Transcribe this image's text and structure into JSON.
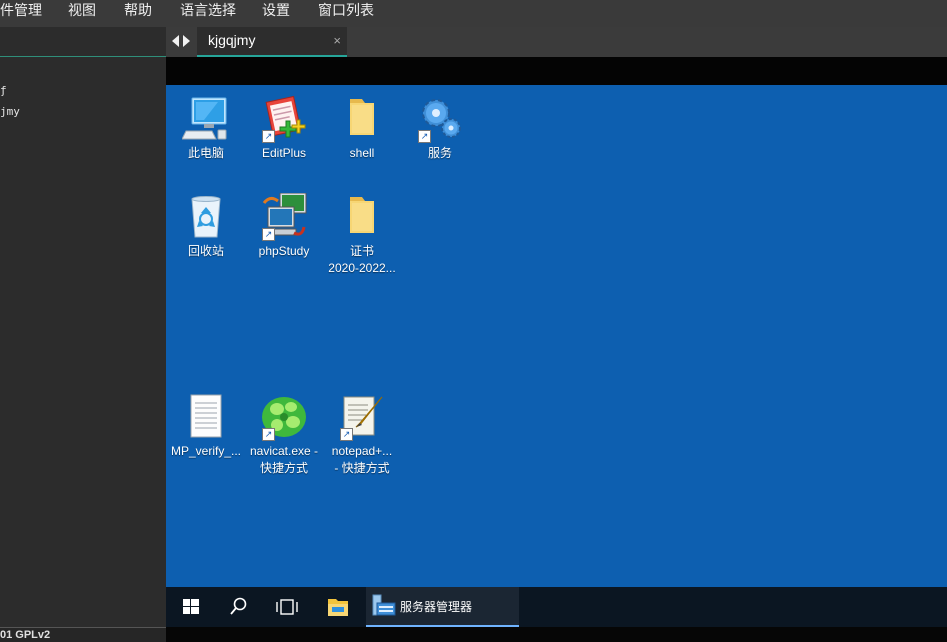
{
  "menu": {
    "items": [
      {
        "label": "件管理"
      },
      {
        "label": "视图"
      },
      {
        "label": "帮助"
      },
      {
        "label": "语言选择"
      },
      {
        "label": "设置"
      },
      {
        "label": "窗口列表"
      }
    ]
  },
  "left_panel": {
    "tree": [
      "ƒ",
      "jmy"
    ],
    "footer": "01 GPLv2"
  },
  "tabs": [
    {
      "label": "kjgqjmy",
      "close": "×"
    }
  ],
  "desktop": {
    "icons": [
      {
        "id": "this-pc",
        "lines": [
          "此电脑"
        ]
      },
      {
        "id": "editplus",
        "lines": [
          "EditPlus"
        ]
      },
      {
        "id": "shell",
        "lines": [
          "shell"
        ]
      },
      {
        "id": "services",
        "lines": [
          "服务"
        ]
      },
      {
        "id": "recycle-bin",
        "lines": [
          "回收站"
        ]
      },
      {
        "id": "phpstudy",
        "lines": [
          "phpStudy"
        ]
      },
      {
        "id": "certificate",
        "lines": [
          "证书",
          "2020-2022..."
        ]
      },
      {
        "id": "mp-verify",
        "lines": [
          "MP_verify_..."
        ]
      },
      {
        "id": "navicat",
        "lines": [
          "navicat.exe -",
          "快捷方式"
        ]
      },
      {
        "id": "notepad",
        "lines": [
          "notepad+...",
          "- 快捷方式"
        ]
      }
    ]
  },
  "taskbar": {
    "app_label": "服务器管理器"
  },
  "colors": {
    "desktop_bg": "#0d5fb0",
    "tab_accent": "#26a69a",
    "taskbar_bg": "#0b1622"
  }
}
